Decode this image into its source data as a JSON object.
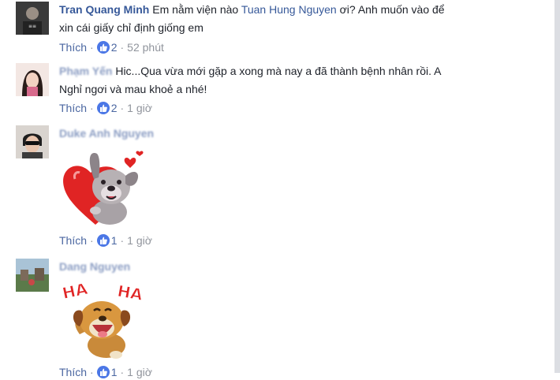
{
  "comments": [
    {
      "author": "Tran Quang Minh",
      "text_before": "Em nằm viện nào ",
      "mention": "Tuan Hung Nguyen",
      "text_after": " ơi? Anh muốn vào để",
      "text_line2": "xin cái giấy chỉ định giống em",
      "like_label": "Thích",
      "reactions": "2",
      "time": "52 phút"
    },
    {
      "author": "Phạm Yến",
      "text": "Hic...Qua vừa mới gặp a xong mà nay a đã thành bệnh nhân rồi. A",
      "text_line2": "Nghỉ ngơi và mau khoẻ a nhé!",
      "like_label": "Thích",
      "reactions": "2",
      "time": "1 giờ"
    },
    {
      "author": "Duke Anh Nguyen",
      "sticker": "puppy-holding-heart-sticker",
      "like_label": "Thích",
      "reactions": "1",
      "time": "1 giờ"
    },
    {
      "author": "Dang Nguyen",
      "sticker": "laughing-dog-haha-sticker",
      "sticker_text_1": "HA",
      "sticker_text_2": "HA",
      "like_label": "Thích",
      "reactions": "1",
      "time": "1 giờ"
    }
  ],
  "separator": "·",
  "colors": {
    "link": "#365899",
    "like_blue": "#4b77e6",
    "meta": "#90949c",
    "sticker_red": "#e02424"
  }
}
